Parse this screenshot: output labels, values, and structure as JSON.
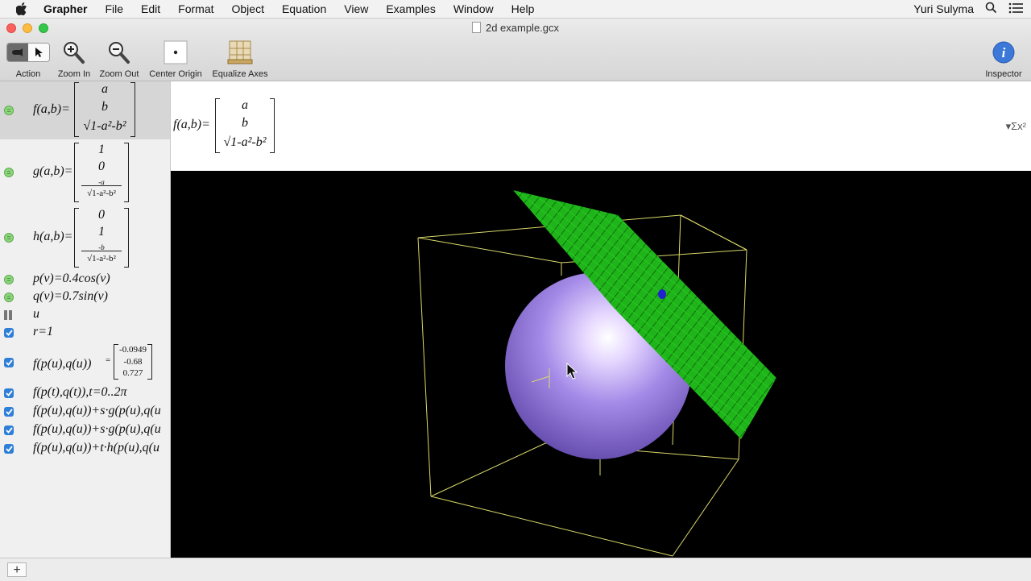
{
  "menubar": {
    "app_name": "Grapher",
    "items": [
      "File",
      "Edit",
      "Format",
      "Object",
      "Equation",
      "View",
      "Examples",
      "Window",
      "Help"
    ],
    "user": "Yuri Sulyma"
  },
  "window": {
    "title": "2d example.gcx"
  },
  "toolbar": {
    "action": "Action",
    "zoom_in": "Zoom In",
    "zoom_out": "Zoom Out",
    "center_origin": "Center Origin",
    "equalize_axes": "Equalize Axes",
    "inspector": "Inspector"
  },
  "equations": {
    "f_name": "f(a,b)=",
    "f_vec": [
      "a",
      "b",
      "√1-a²-b²"
    ],
    "g_name": "g(a,b)=",
    "g_vec": [
      "1",
      "0",
      "-a",
      "√1-a²-b²"
    ],
    "h_name": "h(a,b)=",
    "h_vec": [
      "0",
      "1",
      "-b",
      "√1-a²-b²"
    ],
    "p": "p(v)=0.4cos(v)",
    "q": "q(v)=0.7sin(v)",
    "u": "u",
    "r": "r=1",
    "fpq_name": "f(p(u),q(u))",
    "fpq_eq": "=",
    "fpq_vec": [
      "-0.0949",
      "-0.68",
      "0.727"
    ],
    "curve": "f(p(t),q(t)),t=0..2π",
    "line1": "f(p(u),q(u))+s·g(p(u),q(u",
    "line2": "f(p(u),q(u))+s·g(p(u),q(u",
    "line3": "f(p(u),q(u))+t·h(p(u),q(u"
  },
  "header": {
    "name": "f(a,b)=",
    "vec": [
      "a",
      "b",
      "√1-a²-b²"
    ],
    "sigma": "▾Σx²"
  },
  "colors": {
    "sphere": "#a58be8",
    "plane": "#1fb51a",
    "box": "#d8d86a",
    "point": "#2020d0"
  },
  "add_button": "+"
}
